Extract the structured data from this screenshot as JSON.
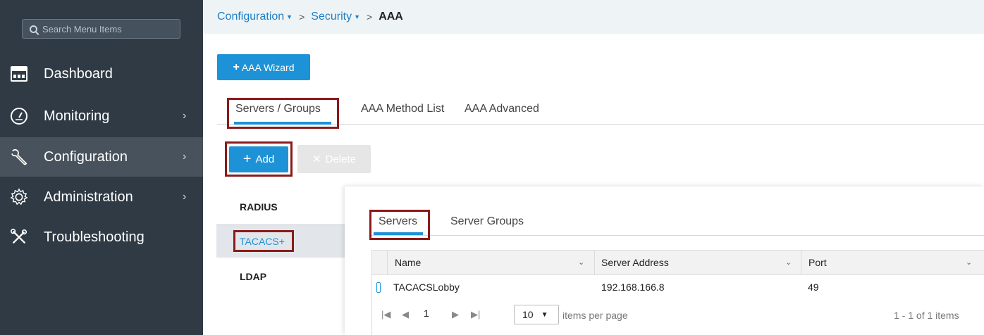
{
  "sidebar": {
    "search_placeholder": "Search Menu Items",
    "items": [
      {
        "label": "Dashboard",
        "icon": "dashboard-icon"
      },
      {
        "label": "Monitoring",
        "icon": "gauge-icon"
      },
      {
        "label": "Configuration",
        "icon": "wrench-icon"
      },
      {
        "label": "Administration",
        "icon": "gear-icon"
      },
      {
        "label": "Troubleshooting",
        "icon": "tools-icon"
      }
    ],
    "active_item": "Configuration"
  },
  "breadcrumb": {
    "items": [
      "Configuration",
      "Security",
      "AAA"
    ],
    "separator": ">"
  },
  "wizard_button": {
    "label": "AAA Wizard"
  },
  "tabs": [
    "Servers / Groups",
    "AAA Method List",
    "AAA Advanced"
  ],
  "active_tab": "Servers / Groups",
  "toolbar": {
    "add_label": "Add",
    "delete_label": "Delete"
  },
  "protocols": [
    "RADIUS",
    "TACACS+",
    "LDAP"
  ],
  "active_protocol": "TACACS+",
  "server_tabs": [
    "Servers",
    "Server Groups"
  ],
  "active_server_tab": "Servers",
  "table": {
    "columns": [
      "Name",
      "Server Address",
      "Port"
    ],
    "rows": [
      {
        "name": "TACACSLobby",
        "address": "192.168.166.8",
        "port": "49"
      }
    ]
  },
  "pagination": {
    "current_page": "1",
    "per_page": "10",
    "per_page_label": "items per page",
    "summary": "1 - 1 of 1 items"
  },
  "colors": {
    "accent": "#1e92d6",
    "sidebar_bg": "#2f3a44",
    "highlight_border": "#8b1a1a"
  }
}
